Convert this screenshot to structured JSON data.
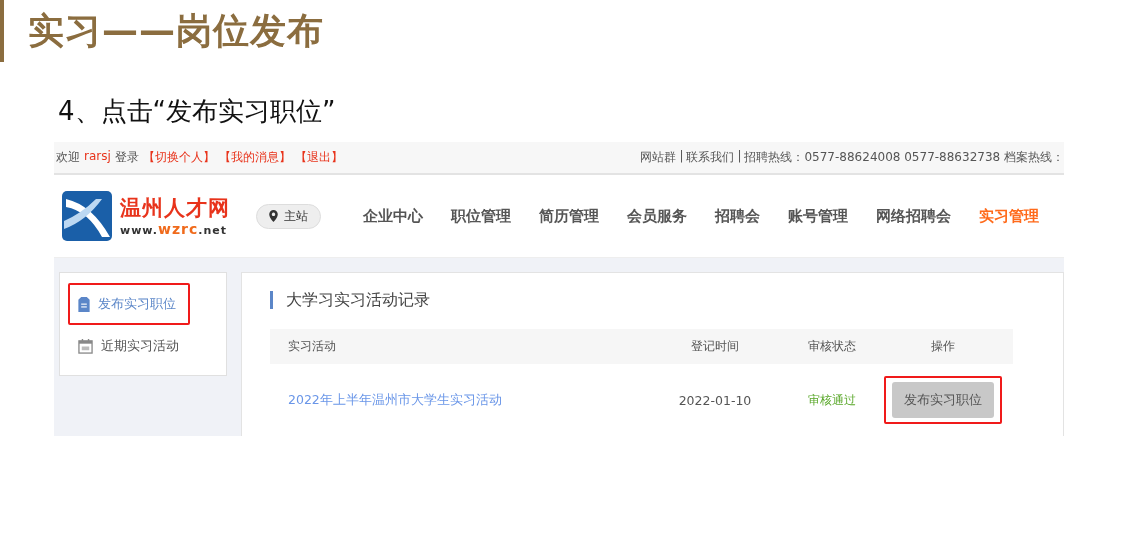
{
  "slide": {
    "title": "实习——岗位发布",
    "step": "4、点击“发布实习职位”"
  },
  "topbar": {
    "welcome": "欢迎",
    "user": "rarsj",
    "login": "登录",
    "links": [
      "【切换个人】",
      "【我的消息】",
      "【退出】"
    ],
    "right": [
      "网站群",
      "|",
      "联系我们",
      "|",
      "招聘热线：0577-88624008 0577-88632738 档案热线："
    ]
  },
  "logo": {
    "name": "温州人才网",
    "url": "www.**wzrc**.net"
  },
  "site_switch": "主站",
  "nav": [
    {
      "label": "企业中心",
      "selected": false
    },
    {
      "label": "职位管理",
      "selected": false
    },
    {
      "label": "简历管理",
      "selected": false
    },
    {
      "label": "会员服务",
      "selected": false
    },
    {
      "label": "招聘会",
      "selected": false
    },
    {
      "label": "账号管理",
      "selected": false
    },
    {
      "label": "网络招聘会",
      "selected": false
    },
    {
      "label": "实习管理",
      "selected": true
    }
  ],
  "sidebar": [
    {
      "label": "发布实习职位",
      "kind": "document",
      "selected": true,
      "highlighted": true
    },
    {
      "label": "近期实习活动",
      "kind": "calendar",
      "selected": false,
      "highlighted": false
    }
  ],
  "panel": {
    "title": "大学习实习活动记录",
    "columns": [
      "实习活动",
      "登记时间",
      "审核状态",
      "操作"
    ],
    "rows": [
      {
        "activity": "2022年上半年温州市大学生实习活动",
        "date": "2022-01-10",
        "status": "审核通过",
        "action": "发布实习职位",
        "highlighted": true
      }
    ]
  }
}
